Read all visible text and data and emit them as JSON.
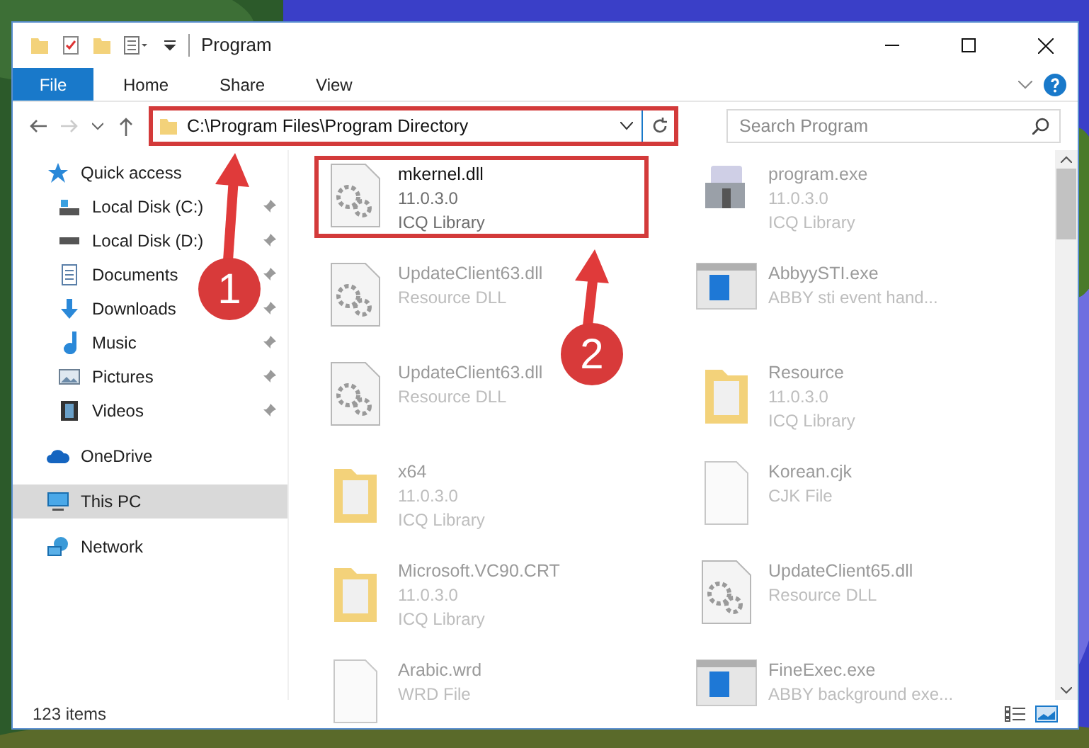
{
  "window": {
    "title": "Program"
  },
  "ribbon": {
    "tabs": [
      {
        "label": "File",
        "selected": true
      },
      {
        "label": "Home",
        "selected": false
      },
      {
        "label": "Share",
        "selected": false
      },
      {
        "label": "View",
        "selected": false
      }
    ]
  },
  "address_bar": {
    "path": "C:\\Program Files\\Program Directory",
    "highlighted": true
  },
  "search": {
    "placeholder": "Search Program"
  },
  "sidebar": {
    "items": [
      {
        "label": "Quick access",
        "selected": false,
        "children": [
          {
            "label": "Local Disk (C:)",
            "pinned": true,
            "selected": false
          },
          {
            "label": "Local Disk (D:)",
            "pinned": true,
            "selected": false
          },
          {
            "label": "Documents",
            "pinned": true,
            "selected": false
          },
          {
            "label": "Downloads",
            "pinned": true,
            "selected": false
          },
          {
            "label": "Music",
            "pinned": true,
            "selected": false
          },
          {
            "label": "Pictures",
            "pinned": true,
            "selected": false
          },
          {
            "label": "Videos",
            "pinned": true,
            "selected": false
          }
        ]
      },
      {
        "label": "OneDrive",
        "selected": false
      },
      {
        "label": "This PC",
        "selected": true
      },
      {
        "label": "Network",
        "selected": false
      }
    ]
  },
  "files": [
    {
      "kind": "gear",
      "name": "mkernel.dll",
      "lines": [
        "11.0.3.0",
        "ICQ Library"
      ],
      "blurred": false,
      "highlighted": true
    },
    {
      "kind": "installer",
      "name": "program.exe",
      "lines": [
        "11.0.3.0",
        "ICQ Library"
      ],
      "blurred": true,
      "highlighted": false
    },
    {
      "kind": "gear",
      "name": "UpdateClient63.dll",
      "lines": [
        "Resource DLL"
      ],
      "blurred": true,
      "highlighted": false
    },
    {
      "kind": "app",
      "name": "AbbyySTI.exe",
      "lines": [
        "ABBY sti event hand..."
      ],
      "blurred": true,
      "highlighted": false
    },
    {
      "kind": "gear",
      "name": "UpdateClient63.dll",
      "lines": [
        "Resource DLL"
      ],
      "blurred": true,
      "highlighted": false
    },
    {
      "kind": "folder",
      "name": "Resource",
      "lines": [
        "11.0.3.0",
        "ICQ Library"
      ],
      "blurred": true,
      "highlighted": false
    },
    {
      "kind": "folder",
      "name": "x64",
      "lines": [
        "11.0.3.0",
        "ICQ Library"
      ],
      "blurred": true,
      "highlighted": false
    },
    {
      "kind": "blank",
      "name": "Korean.cjk",
      "lines": [
        "CJK File"
      ],
      "blurred": true,
      "highlighted": false
    },
    {
      "kind": "folder",
      "name": "Microsoft.VC90.CRT",
      "lines": [
        "11.0.3.0",
        "ICQ Library"
      ],
      "blurred": true,
      "highlighted": false
    },
    {
      "kind": "gear",
      "name": "UpdateClient65.dll",
      "lines": [
        "Resource DLL"
      ],
      "blurred": true,
      "highlighted": false
    },
    {
      "kind": "blank",
      "name": "Arabic.wrd",
      "lines": [
        "WRD File"
      ],
      "blurred": true,
      "highlighted": false
    },
    {
      "kind": "app",
      "name": "FineExec.exe",
      "lines": [
        "ABBY background exe..."
      ],
      "blurred": true,
      "highlighted": false
    }
  ],
  "status_bar": {
    "count": "123 items"
  },
  "annotations": [
    {
      "label": "1"
    },
    {
      "label": "2"
    }
  ]
}
